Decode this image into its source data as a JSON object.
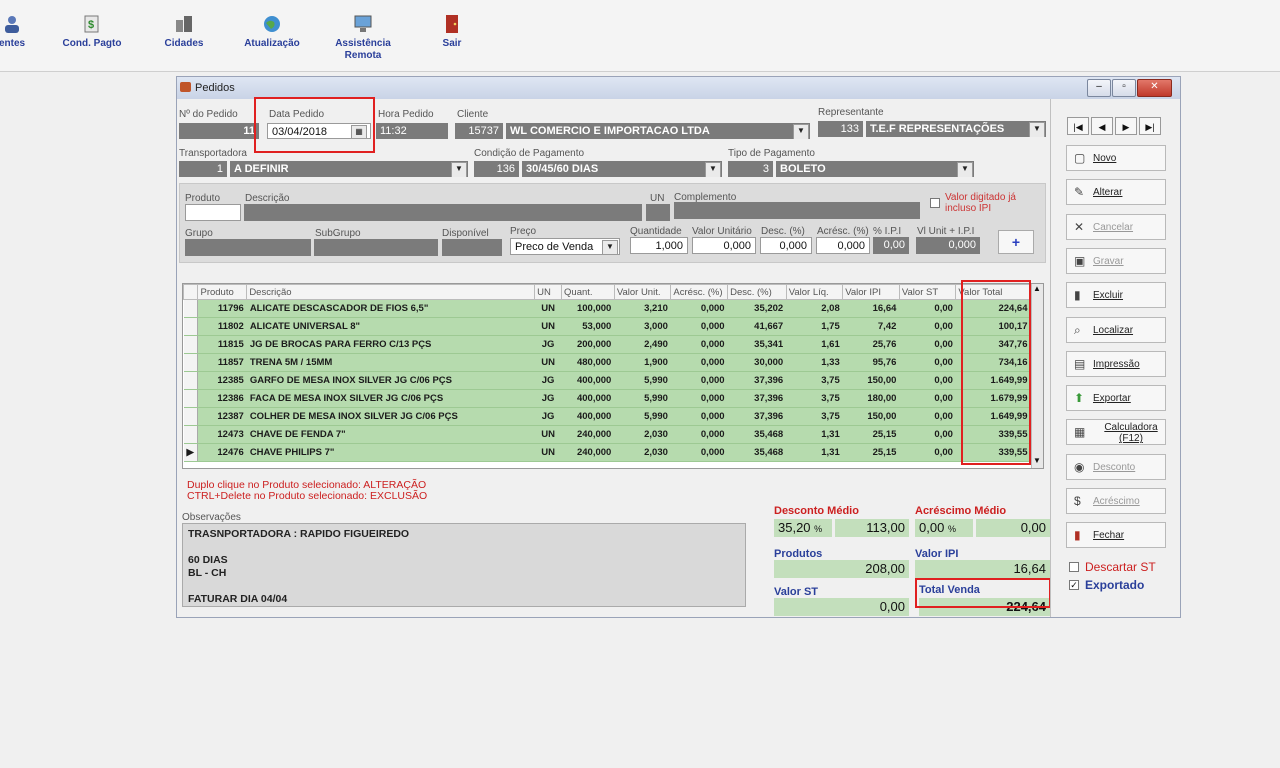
{
  "toolbar": {
    "items": [
      {
        "label": "entes"
      },
      {
        "label": "Cond. Pagto"
      },
      {
        "label": "Cidades"
      },
      {
        "label": "Atualização"
      },
      {
        "label": "Assistência Remota"
      },
      {
        "label": "Sair"
      }
    ]
  },
  "window": {
    "title": "Pedidos",
    "controls": {
      "minimize": "‒",
      "maximize": "▫",
      "close": "✕"
    }
  },
  "header": {
    "pedido_label": "Nº do Pedido",
    "pedido_value": "11",
    "data_label": "Data Pedido",
    "data_value": "03/04/2018",
    "hora_label": "Hora Pedido",
    "hora_value": "11:32",
    "cliente_label": "Cliente",
    "cliente_code": "15737",
    "cliente_name": "WL COMERCIO E IMPORTACAO LTDA",
    "representante_label": "Representante",
    "representante_code": "133",
    "representante_name": "T.E.F REPRESENTAÇÕES",
    "transportadora_label": "Transportadora",
    "transportadora_code": "1",
    "transportadora_name": "A DEFINIR",
    "condicao_label": "Condição de Pagamento",
    "condicao_code": "136",
    "condicao_name": "30/45/60 DIAS",
    "tipo_label": "Tipo de Pagamento",
    "tipo_code": "3",
    "tipo_name": "BOLETO"
  },
  "item_entry": {
    "produto_label": "Produto",
    "descricao_label": "Descrição",
    "un_label": "UN",
    "complemento_label": "Complemento",
    "ipi_check_label": "Valor digitado já incluso IPI",
    "grupo_label": "Grupo",
    "subgrupo_label": "SubGrupo",
    "disponivel_label": "Disponível",
    "preco_label": "Preço",
    "preco_value": "Preco de Venda",
    "quantidade_label": "Quantidade",
    "quantidade_value": "1,000",
    "valor_unitario_label": "Valor Unitário",
    "valor_unitario_value": "0,000",
    "desc_label": "Desc. (%)",
    "desc_value": "0,000",
    "acresc_label": "Acrésc. (%)",
    "acresc_value": "0,000",
    "ipi_label": "% I.P.I",
    "ipi_value": "0,00",
    "vlunit_ipi_label": "Vl Unit + I.P.I",
    "vlunit_ipi_value": "0,000",
    "add_label": "+"
  },
  "grid": {
    "columns": [
      "Produto",
      "Descrição",
      "UN",
      "Quant.",
      "Valor Unit.",
      "Acrésc. (%)",
      "Desc. (%)",
      "Valor Líq.",
      "Valor IPI",
      "Valor ST",
      "Valor Total"
    ],
    "rows": [
      [
        "11796",
        "ALICATE DESCASCADOR DE FIOS 6,5\"",
        "UN",
        "100,000",
        "3,210",
        "0,000",
        "35,202",
        "2,08",
        "16,64",
        "0,00",
        "224,64"
      ],
      [
        "11802",
        "ALICATE UNIVERSAL 8\"",
        "UN",
        "53,000",
        "3,000",
        "0,000",
        "41,667",
        "1,75",
        "7,42",
        "0,00",
        "100,17"
      ],
      [
        "11815",
        "JG DE BROCAS PARA FERRO C/13 PÇS",
        "JG",
        "200,000",
        "2,490",
        "0,000",
        "35,341",
        "1,61",
        "25,76",
        "0,00",
        "347,76"
      ],
      [
        "11857",
        "TRENA 5M / 15MM",
        "UN",
        "480,000",
        "1,900",
        "0,000",
        "30,000",
        "1,33",
        "95,76",
        "0,00",
        "734,16"
      ],
      [
        "12385",
        "GARFO DE MESA INOX SILVER JG C/06 PÇS",
        "JG",
        "400,000",
        "5,990",
        "0,000",
        "37,396",
        "3,75",
        "150,00",
        "0,00",
        "1.649,99"
      ],
      [
        "12386",
        "FACA DE MESA INOX SILVER JG C/06 PÇS",
        "JG",
        "400,000",
        "5,990",
        "0,000",
        "37,396",
        "3,75",
        "180,00",
        "0,00",
        "1.679,99"
      ],
      [
        "12387",
        "COLHER DE MESA INOX SILVER JG C/06 PÇS",
        "JG",
        "400,000",
        "5,990",
        "0,000",
        "37,396",
        "3,75",
        "150,00",
        "0,00",
        "1.649,99"
      ],
      [
        "12473",
        "CHAVE DE FENDA 7\"",
        "UN",
        "240,000",
        "2,030",
        "0,000",
        "35,468",
        "1,31",
        "25,15",
        "0,00",
        "339,55"
      ],
      [
        "12476",
        "CHAVE PHILIPS 7\"",
        "UN",
        "240,000",
        "2,030",
        "0,000",
        "35,468",
        "1,31",
        "25,15",
        "0,00",
        "339,55"
      ]
    ],
    "current_row_marker": "▶"
  },
  "hints": {
    "line1": "Duplo clique no Produto selecionado: ALTERAÇÃO",
    "line2": "CTRL+Delete no Produto selecionado: EXCLUSÃO"
  },
  "observacoes": {
    "label": "Observações",
    "lines": [
      "TRASNPORTADORA : RAPIDO FIGUEIREDO",
      "",
      "60 DIAS",
      "BL - CH",
      "",
      "FATURAR DIA 04/04"
    ]
  },
  "totals": {
    "desconto_medio_label": "Desconto Médio",
    "desconto_medio_pct": "35,20",
    "desconto_medio_value": "113,00",
    "acrescimo_medio_label": "Acréscimo Médio",
    "acrescimo_medio_pct": "0,00",
    "acrescimo_medio_value": "0,00",
    "pct_symbol": "%",
    "produtos_label": "Produtos",
    "produtos_value": "208,00",
    "valor_ipi_label": "Valor IPI",
    "valor_ipi_value": "16,64",
    "valor_st_label": "Valor ST",
    "valor_st_value": "0,00",
    "total_venda_label": "Total Venda",
    "total_venda_value": "224,64"
  },
  "sidebar": {
    "nav": [
      "|◀",
      "◀",
      "▶",
      "▶|"
    ],
    "buttons": [
      {
        "label": "Novo",
        "enabled": true
      },
      {
        "label": "Alterar",
        "enabled": true
      },
      {
        "label": "Cancelar",
        "enabled": false
      },
      {
        "label": "Gravar",
        "enabled": false
      },
      {
        "label": "Excluir",
        "enabled": true
      },
      {
        "label": "Localizar",
        "enabled": true
      },
      {
        "label": "Impressão",
        "enabled": true
      },
      {
        "label": "Exportar",
        "enabled": true
      },
      {
        "label": "Calculadora (F12)",
        "enabled": true
      },
      {
        "label": "Desconto",
        "enabled": false
      },
      {
        "label": "Acréscimo",
        "enabled": false
      },
      {
        "label": "Fechar",
        "enabled": true
      }
    ],
    "descartar_st_label": "Descartar ST",
    "exportado_label": "Exportado",
    "exportado_checked": true
  },
  "colors": {
    "highlight": "#e02020",
    "grid_row": "#b6dbae",
    "field_bg": "#7b7b7b",
    "total_label": "#cc2020",
    "link_blue": "#2a3f9a"
  }
}
